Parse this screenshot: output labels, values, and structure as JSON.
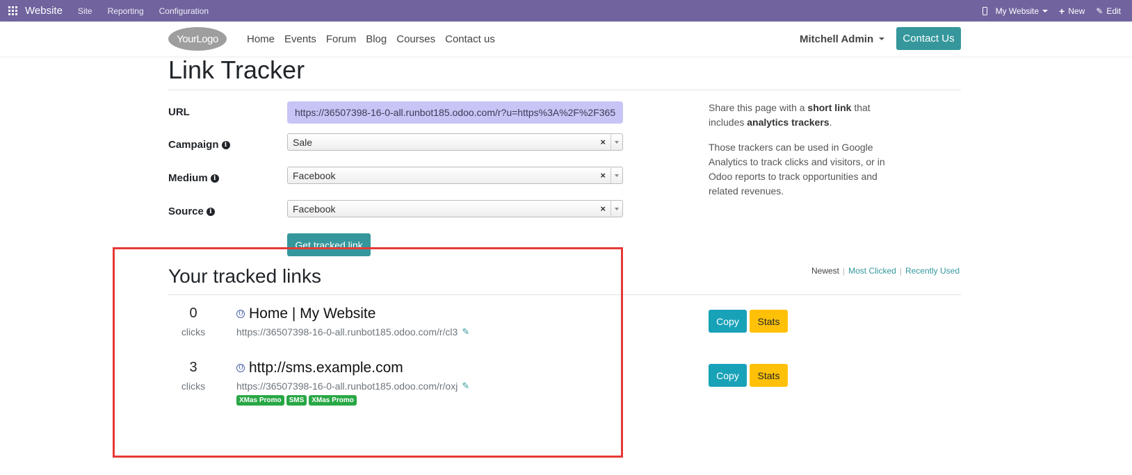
{
  "topbar": {
    "app_name": "Website",
    "menus": [
      "Site",
      "Reporting",
      "Configuration"
    ],
    "website_selector": "My Website",
    "new_label": "New",
    "edit_label": "Edit"
  },
  "sitenav": {
    "logo": "YourLogo",
    "links": [
      "Home",
      "Events",
      "Forum",
      "Blog",
      "Courses",
      "Contact us"
    ],
    "user": "Mitchell Admin",
    "contact_button": "Contact Us"
  },
  "page": {
    "title": "Link Tracker"
  },
  "form": {
    "url_label": "URL",
    "url_value": "https://36507398-16-0-all.runbot185.odoo.com/r?u=https%3A%2F%2F365",
    "campaign_label": "Campaign",
    "campaign_value": "Sale",
    "medium_label": "Medium",
    "medium_value": "Facebook",
    "source_label": "Source",
    "source_value": "Facebook",
    "submit_label": "Get tracked link"
  },
  "help": {
    "line1_pre": "Share this page with a ",
    "line1_bold": "short link",
    "line1_mid": " that includes ",
    "line1_bold2": "analytics trackers",
    "line1_end": ".",
    "line2": "Those trackers can be used in Google Analytics to track clicks and visitors, or in Odoo reports to track opportunities and related revenues."
  },
  "tracked": {
    "title": "Your tracked links",
    "sort_options": [
      "Newest",
      "Most Clicked",
      "Recently Used"
    ],
    "clicks_label": "clicks",
    "copy_label": "Copy",
    "stats_label": "Stats",
    "links": [
      {
        "clicks": "0",
        "title": "Home | My Website",
        "short_url": "https://36507398-16-0-all.runbot185.odoo.com/r/cl3",
        "tags": []
      },
      {
        "clicks": "3",
        "title": "http://sms.example.com",
        "short_url": "https://36507398-16-0-all.runbot185.odoo.com/r/oxj",
        "tags": [
          "XMas Promo",
          "SMS",
          "XMas Promo"
        ]
      }
    ]
  },
  "colors": {
    "topbar": "#71639e",
    "primary": "#35979c",
    "copy": "#17a2b8",
    "stats": "#ffc107",
    "tag": "#28a745",
    "highlight": "#e53935"
  }
}
